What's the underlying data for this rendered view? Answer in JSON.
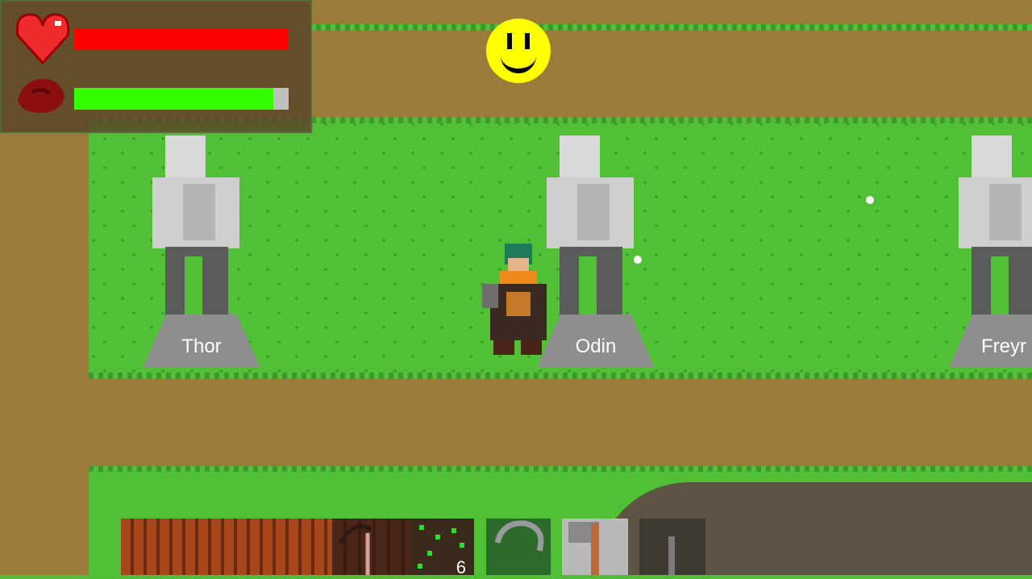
{
  "hud": {
    "health_icon": "heart-icon",
    "health_fraction": 1.0,
    "health_color": "#ff0000",
    "stamina_icon": "meat-icon",
    "stamina_fraction": 0.93,
    "stamina_color": "#33ff00"
  },
  "statues": [
    {
      "name": "Thor"
    },
    {
      "name": "Odin"
    },
    {
      "name": "Freyr"
    }
  ],
  "mood_icon": "smiley-icon",
  "hotbar": {
    "slots": [
      {
        "icon": "wood-planks-icon",
        "count": ""
      },
      {
        "icon": "bow-icon",
        "count": ""
      },
      {
        "icon": "seeds-icon",
        "count": "6"
      },
      {
        "icon": "sickle-icon",
        "count": ""
      },
      {
        "icon": "hammer-icon",
        "count": ""
      },
      {
        "icon": "knife-icon",
        "count": ""
      }
    ]
  },
  "colors": {
    "grass": "#52c037",
    "dirt": "#9c7a3a"
  }
}
